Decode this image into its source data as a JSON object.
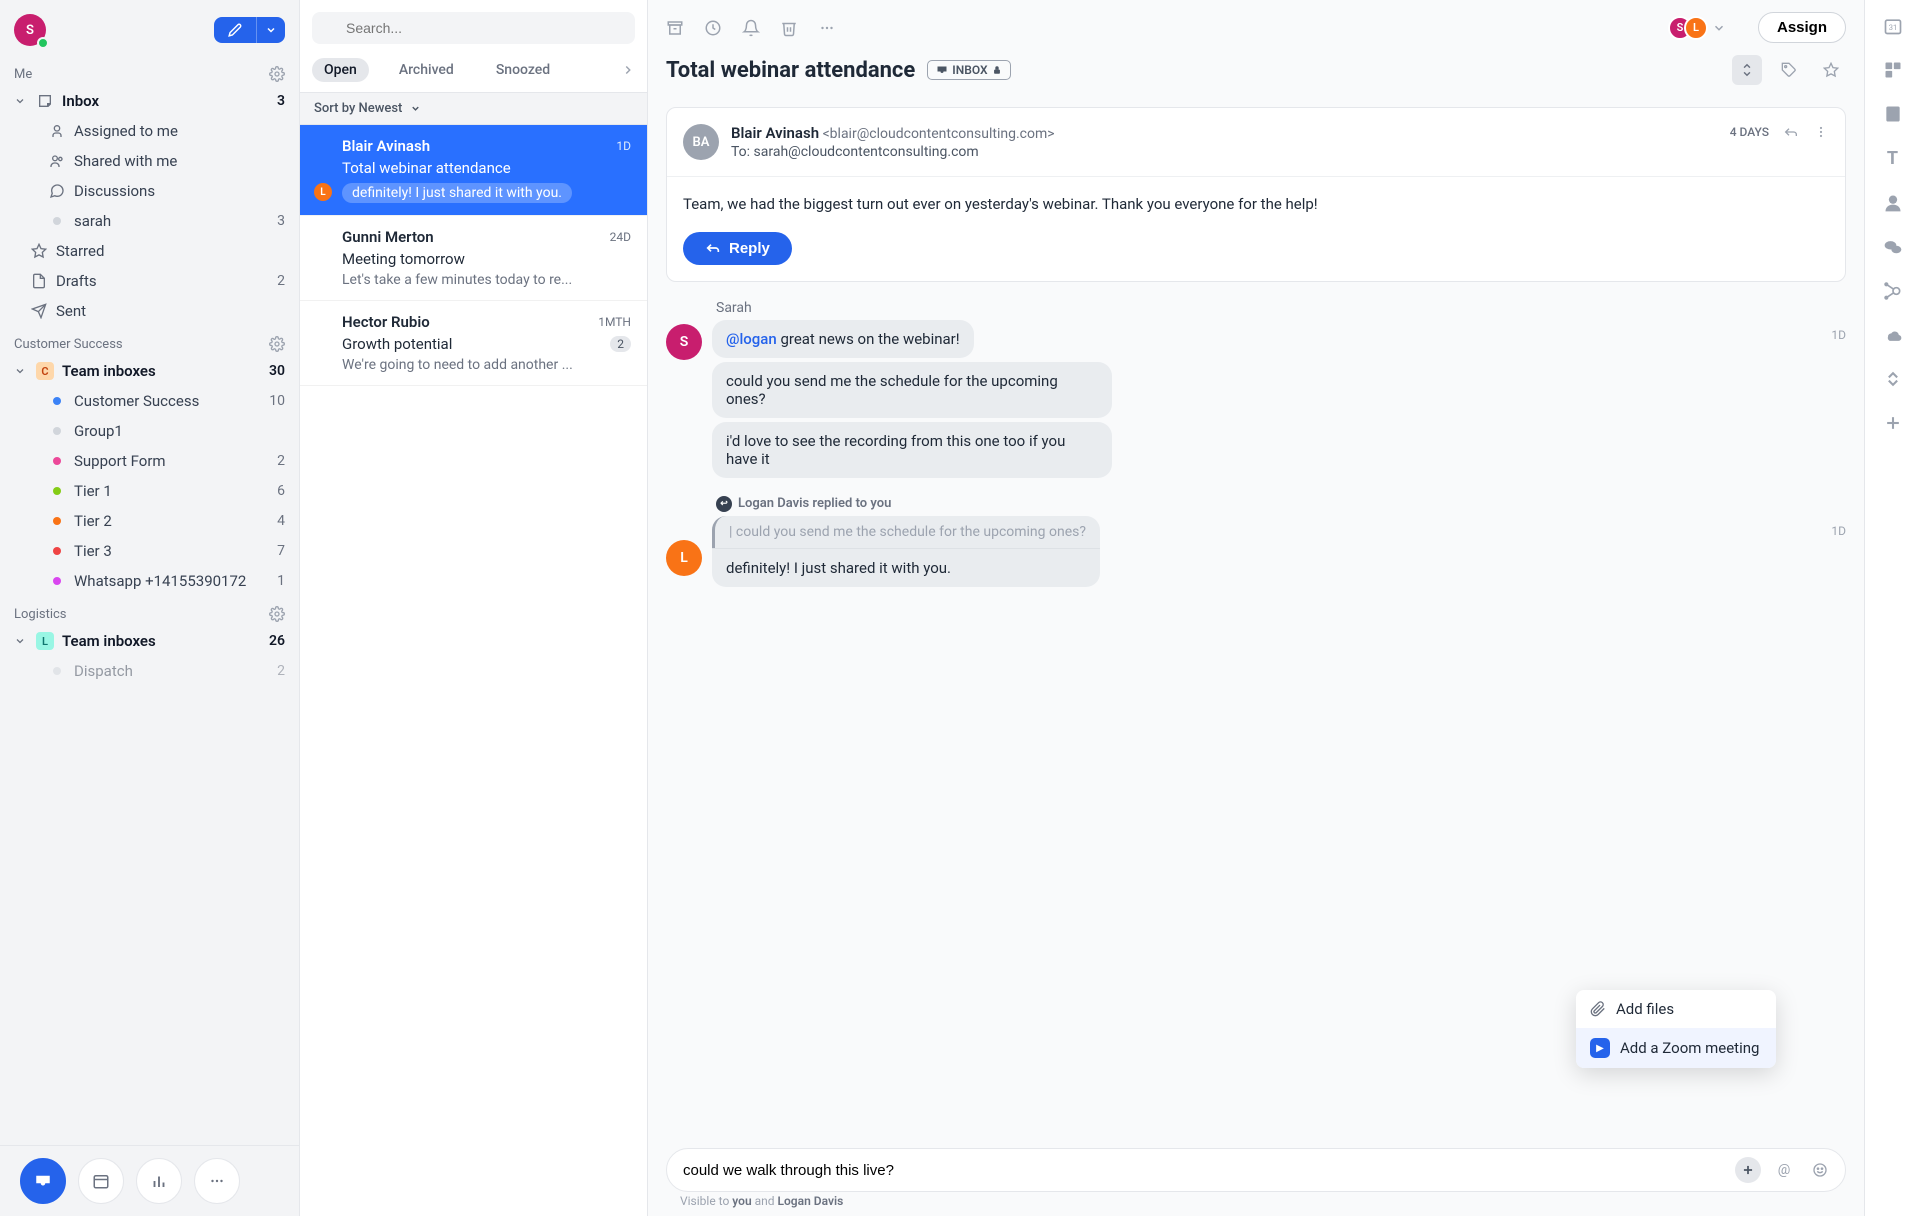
{
  "user_avatar": {
    "initial": "S",
    "color": "#c81e6e"
  },
  "sidebar": {
    "me_label": "Me",
    "inbox": {
      "label": "Inbox",
      "count": "3"
    },
    "me_items": [
      {
        "label": "Assigned to me",
        "icon": "user"
      },
      {
        "label": "Shared with me",
        "icon": "users"
      },
      {
        "label": "Discussions",
        "icon": "chat"
      },
      {
        "label": "sarah",
        "icon": "dot",
        "count": "3",
        "dot": "#d1d5db"
      }
    ],
    "other_items": [
      {
        "label": "Starred",
        "icon": "star"
      },
      {
        "label": "Drafts",
        "icon": "draft",
        "count": "2"
      },
      {
        "label": "Sent",
        "icon": "send"
      }
    ],
    "cs_label": "Customer Success",
    "cs_team": {
      "label": "Team inboxes",
      "count": "30",
      "badge": "C",
      "badge_bg": "#fed7aa",
      "badge_fg": "#c2410c"
    },
    "cs_items": [
      {
        "label": "Customer Success",
        "count": "10",
        "dot": "#3b82f6"
      },
      {
        "label": "Group1",
        "count": "",
        "dot": "#d1d5db"
      },
      {
        "label": "Support Form",
        "count": "2",
        "dot": "#ec4899"
      },
      {
        "label": "Tier 1",
        "count": "6",
        "dot": "#84cc16"
      },
      {
        "label": "Tier 2",
        "count": "4",
        "dot": "#f97316"
      },
      {
        "label": "Tier 3",
        "count": "7",
        "dot": "#ef4444"
      },
      {
        "label": "Whatsapp +14155390172",
        "count": "1",
        "dot": "#d946ef"
      }
    ],
    "logistics_label": "Logistics",
    "log_team": {
      "label": "Team inboxes",
      "count": "26",
      "badge": "L",
      "badge_bg": "#99f6e4",
      "badge_fg": "#0f766e"
    },
    "log_items": [
      {
        "label": "Dispatch",
        "count": "2",
        "dot": "#d1d5db",
        "faded": true
      }
    ]
  },
  "search_placeholder": "Search...",
  "tabs": {
    "open": "Open",
    "archived": "Archived",
    "snoozed": "Snoozed"
  },
  "sort_label": "Sort by Newest",
  "conversations": [
    {
      "name": "Blair Avinash",
      "time": "1D",
      "subject": "Total webinar attendance",
      "pill": "definitely! I just shared it with you.",
      "avatar": "L",
      "avatar_bg": "#f97316",
      "selected": true
    },
    {
      "name": "Gunni Merton",
      "time": "24D",
      "subject": "Meeting tomorrow",
      "preview": "Let's take a few minutes today to re..."
    },
    {
      "name": "Hector Rubio",
      "time": "1MTH",
      "subject": "Growth potential",
      "preview": "We're going to need to add another ...",
      "badge": "2"
    }
  ],
  "conversation_title": "Total webinar attendance",
  "folder_badge": "INBOX",
  "assignees": [
    {
      "initial": "S",
      "color": "#c81e6e"
    },
    {
      "initial": "L",
      "color": "#f97316"
    }
  ],
  "assign_label": "Assign",
  "email": {
    "avatar_initials": "BA",
    "sender_name": "Blair Avinash",
    "sender_email": "<blair@cloudcontentconsulting.com>",
    "to_line": "To: sarah@cloudcontentconsulting.com",
    "time": "4 DAYS",
    "body": "Team, we had the biggest turn out ever on yesterday's webinar. Thank you everyone for the help!",
    "reply_label": "Reply"
  },
  "comments": {
    "sarah": {
      "name": "Sarah",
      "avatar_initial": "S",
      "avatar_color": "#c81e6e",
      "time": "1D",
      "mention": "@logan",
      "msg1_rest": " great news on the webinar!",
      "msg2": "could you send me the schedule for the upcoming ones?",
      "msg3": "i'd love to see the recording from this one too if you have it"
    },
    "logan": {
      "header": "Logan Davis replied to you",
      "avatar_initial": "L",
      "avatar_color": "#f97316",
      "time": "1D",
      "quote": "could you send me the schedule for the upcoming ones?",
      "msg": "definitely! I just shared it with you."
    }
  },
  "popup": {
    "add_files": "Add files",
    "add_zoom": "Add a Zoom meeting"
  },
  "composer_value": "could we walk through this live?",
  "visibility_prefix": "Visible to ",
  "visibility_you": "you",
  "visibility_and": " and ",
  "visibility_other": "Logan Davis"
}
